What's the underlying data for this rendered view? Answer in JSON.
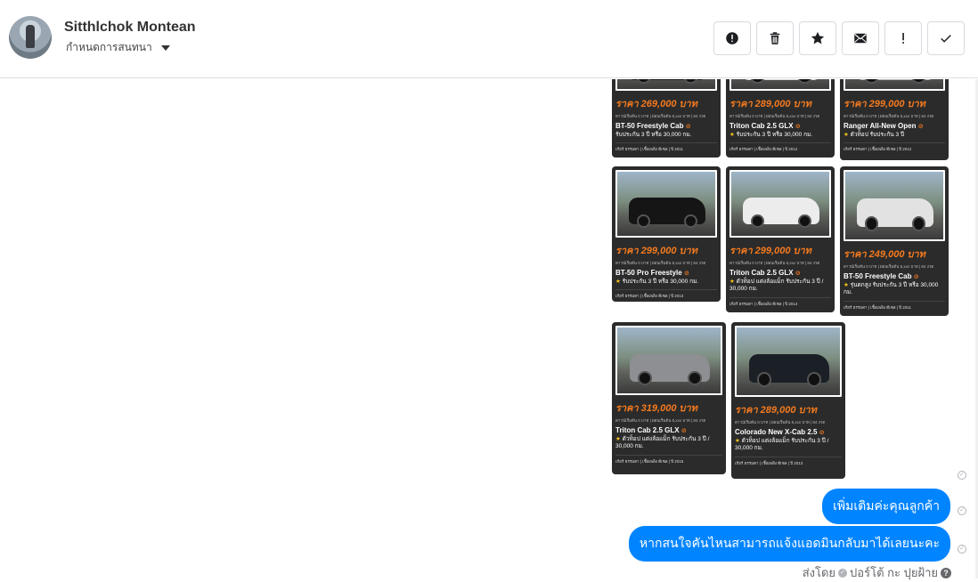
{
  "header": {
    "contact_name": "Sitthlchok Montean",
    "subtitle": "กำหนดการสนทนา"
  },
  "toolbar": [
    {
      "name": "spam-button",
      "icon": "alert-circle-icon"
    },
    {
      "name": "delete-button",
      "icon": "trash-icon"
    },
    {
      "name": "star-button",
      "icon": "star-icon"
    },
    {
      "name": "mark-unread-button",
      "icon": "envelope-icon"
    },
    {
      "name": "follow-up-button",
      "icon": "exclamation-icon"
    },
    {
      "name": "mark-done-button",
      "icon": "checkmark-icon"
    }
  ],
  "cards": [
    {
      "price": "ราคา 269,000 บาท",
      "fine": "ดาวน์เริ่มต้น 0 บาท | ผ่อนเริ่มต้น 5,xxx บาท | 84 งวด",
      "model": "BT-50 Freestyle Cab",
      "warranty": "รับประกัน 3 ปี หรือ 30,000 กม.",
      "star": false,
      "foot": "เกียร์ ธรรมดา | เชื้อเพลิง ดีเซล | ปี 2011",
      "car_color": "#1a1a1a"
    },
    {
      "price": "ราคา 289,000 บาท",
      "fine": "ดาวน์เริ่มต้น 0 บาท | ผ่อนเริ่มต้น 5,xxx บาท | 84 งวด",
      "model": "Triton Cab 2.5 GLX",
      "warranty": "รับประกัน 3 ปี หรือ 30,000 กม.",
      "star": true,
      "foot": "เกียร์ ธรรมดา | เชื้อเพลิง ดีเซล | ปี 2012",
      "car_color": "#d8d8d8"
    },
    {
      "price": "ราคา 299,000 บาท",
      "fine": "ดาวน์เริ่มต้น 0 บาท | ผ่อนเริ่มต้น 5,xxx บาท | 84 งวด",
      "model": "Ranger All-New Open",
      "warranty": "ตัวท็อป รับประกัน 3 ปี",
      "star": true,
      "foot": "เกียร์ ธรรมดา | เชื้อเพลิง ดีเซล | ปี 2012",
      "car_color": "#b9b9b9"
    },
    {
      "price": "ราคา 299,000 บาท",
      "fine": "ดาวน์เริ่มต้น 0 บาท | ผ่อนเริ่มต้น 5,xxx บาท | 84 งวด",
      "model": "BT-50 Pro Freestyle",
      "warranty": "รับประกัน 3 ปี หรือ 30,000 กม.",
      "star": true,
      "foot": "เกียร์ ธรรมดา | เชื้อเพลิง ดีเซล | ปี 2013",
      "car_color": "#151515"
    },
    {
      "price": "ราคา 299,000 บาท",
      "fine": "ดาวน์เริ่มต้น 0 บาท | ผ่อนเริ่มต้น 5,xxx บาท | 84 งวด",
      "model": "Triton Cab 2.5 GLX",
      "warranty": "ตัวท็อป แต่งล้อแม็ก รับประกัน 3 ปี / 30,000 กม.",
      "star": true,
      "foot": "เกียร์ ธรรมดา | เชื้อเพลิง ดีเซล | ปี 2014",
      "car_color": "#ececec"
    },
    {
      "price": "ราคา 249,000 บาท",
      "fine": "ดาวน์เริ่มต้น 0 บาท | ผ่อนเริ่มต้น 5,xxx บาท | 84 งวด",
      "model": "BT-50 Freestyle Cab",
      "warranty": "รุ่นตกสูง รับประกัน 3 ปี หรือ 30,000 กม.",
      "star": true,
      "foot": "เกียร์ ธรรมดา | เชื้อเพลิง ดีเซล | ปี 2011",
      "car_color": "#e2e2e2"
    },
    {
      "price": "ราคา 319,000 บาท",
      "fine": "ดาวน์เริ่มต้น 0 บาท | ผ่อนเริ่มต้น 5,xxx บาท | 84 งวด",
      "model": "Triton Cab 2.5 GLX",
      "warranty": "ตัวท็อป แต่งล้อแม็ก รับประกัน 3 ปี / 30,000 กม.",
      "star": true,
      "foot": "เกียร์ ธรรมดา | เชื้อเพลิง ดีเซล | ปี 2015",
      "car_color": "#8d8f92"
    },
    {
      "price": "ราคา 289,000 บาท",
      "fine": "ดาวน์เริ่มต้น 0 บาท | ผ่อนเริ่มต้น 5,xxx บาท | 84 งวด",
      "model": "Colorado New X-Cab 2.5",
      "warranty": "ตัวท็อป แต่งล้อแม็ก รับประกัน 3 ปี / 30,000 กม.",
      "star": true,
      "foot": "เกียร์ ธรรมดา | เชื้อเพลิง ดีเซล | ปี 2013",
      "car_color": "#1b1f26"
    }
  ],
  "messages": [
    {
      "text": "เพิ่มเติมค่ะคุณลูกค้า"
    },
    {
      "text": "หากสนใจคันไหนสามารถแจ้งแอดมินกลับมาได้เลยนะคะ"
    }
  ],
  "sent_by": {
    "prefix": "ส่งโดย",
    "author": "ปอร์โต้ กะ ปุยฝ้าย",
    "help": "?"
  },
  "colors": {
    "accent": "#0084ff",
    "price": "#f47a1f",
    "card_bg": "#2b2b2b"
  }
}
